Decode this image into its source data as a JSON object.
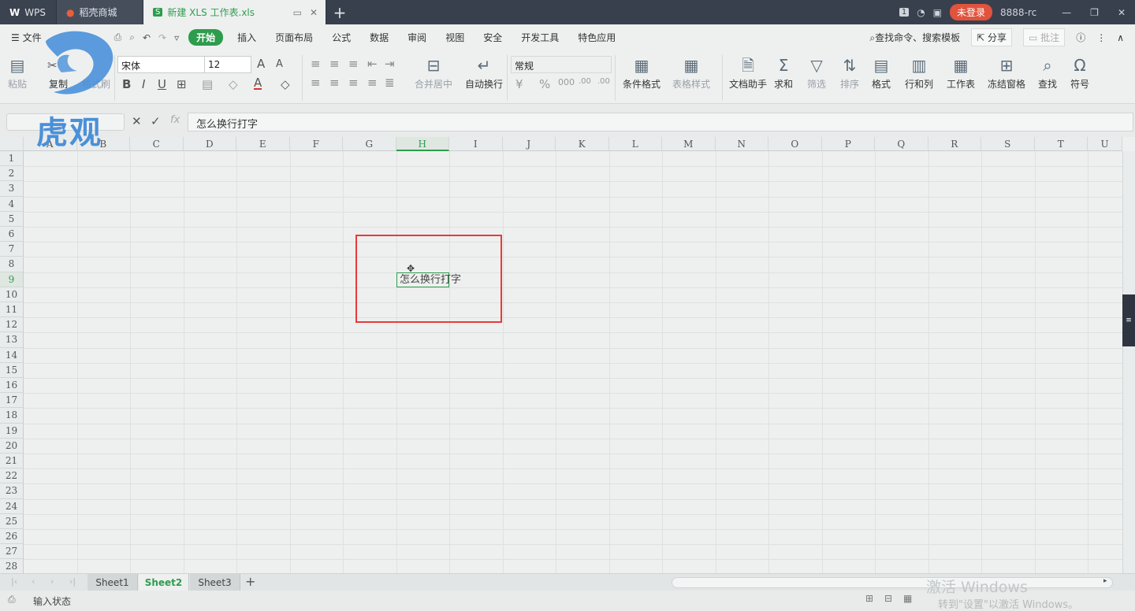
{
  "window": {
    "tabs": [
      {
        "label": "WPS"
      },
      {
        "label": "稻壳商城"
      },
      {
        "label": "新建 XLS 工作表.xls"
      }
    ],
    "login_label": "未登录",
    "user_label": "8888-rc",
    "badge_count": "1"
  },
  "menu": {
    "items": [
      "文件",
      "开始",
      "插入",
      "页面布局",
      "公式",
      "数据",
      "审阅",
      "视图",
      "安全",
      "开发工具",
      "特色应用"
    ],
    "active": "开始",
    "search_label": "查找命令、搜索模板",
    "share_label": "分享",
    "comment_label": "批注"
  },
  "ribbon": {
    "paste_label": "粘贴",
    "cut_label": "剪切",
    "copy_label": "复制",
    "format_painter_label": "格式刷",
    "font_name": "宋体",
    "font_size": "12",
    "merge_label": "合并居中",
    "wrap_label": "自动换行",
    "number_format": "常规",
    "cond_format_label": "条件格式",
    "table_style_label": "表格样式",
    "doc_assistant_label": "文档助手",
    "sum_label": "求和",
    "filter_label": "筛选",
    "sort_label": "排序",
    "format_label": "格式",
    "rowcol_label": "行和列",
    "sheet_label": "工作表",
    "freeze_label": "冻结窗格",
    "find_label": "查找",
    "symbol_label": "符号"
  },
  "formula": {
    "fx_label": "fx",
    "content": "怎么换行打字"
  },
  "grid": {
    "columns": [
      "A",
      "B",
      "C",
      "D",
      "E",
      "F",
      "G",
      "H",
      "I",
      "J",
      "K",
      "L",
      "M",
      "N",
      "O",
      "P",
      "Q",
      "R",
      "S",
      "T",
      "U"
    ],
    "selected_column": "H",
    "rows": [
      "1",
      "2",
      "3",
      "4",
      "5",
      "6",
      "7",
      "8",
      "9",
      "10",
      "11",
      "12",
      "13",
      "14",
      "15",
      "16",
      "17",
      "18",
      "19",
      "20",
      "21",
      "22",
      "23",
      "24",
      "25",
      "26",
      "27",
      "28"
    ],
    "selected_row": "9",
    "active_cell_value": "怎么换行打字"
  },
  "sheets": {
    "tabs": [
      "Sheet1",
      "Sheet2",
      "Sheet3"
    ],
    "active": "Sheet2"
  },
  "status": {
    "mode_label": "输入状态"
  },
  "watermark": {
    "logo_text": "虎观",
    "windows_line1": "激活 Windows",
    "windows_line2": "转到\"设置\"以激活 Windows。"
  },
  "colors": {
    "accent": "#2e9c4d",
    "highlight_box": "#e83a3a",
    "titlebar": "#39404d"
  }
}
